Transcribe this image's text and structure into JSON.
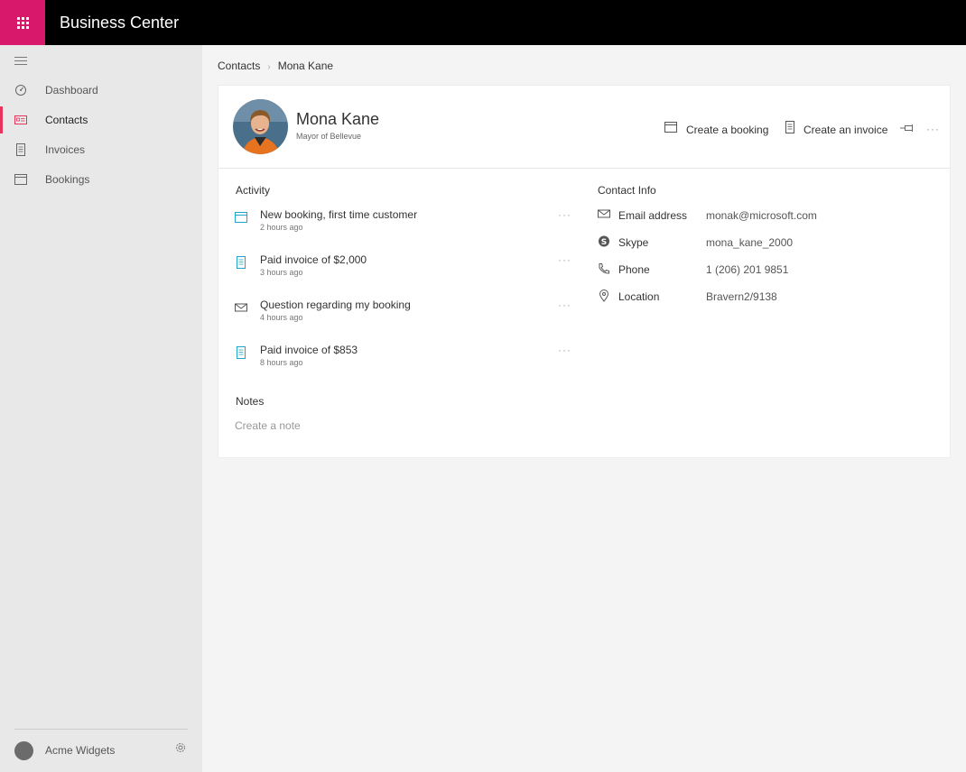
{
  "app": {
    "title": "Business Center"
  },
  "sidebar": {
    "items": [
      {
        "label": "Dashboard",
        "icon": "dashboard-icon"
      },
      {
        "label": "Contacts",
        "icon": "contact-card-icon",
        "active": true
      },
      {
        "label": "Invoices",
        "icon": "invoice-icon"
      },
      {
        "label": "Bookings",
        "icon": "calendar-icon"
      }
    ],
    "org": {
      "name": "Acme Widgets"
    }
  },
  "breadcrumb": {
    "parent": "Contacts",
    "current": "Mona Kane"
  },
  "contact": {
    "name": "Mona Kane",
    "title": "Mayor of Bellevue",
    "actions": {
      "booking": "Create a booking",
      "invoice": "Create an invoice"
    }
  },
  "activity": {
    "title": "Activity",
    "items": [
      {
        "title": "New booking, first time customer",
        "time": "2 hours ago",
        "icon": "calendar-icon"
      },
      {
        "title": "Paid invoice of $2,000",
        "time": "3 hours ago",
        "icon": "invoice-icon"
      },
      {
        "title": "Question regarding my booking",
        "time": "4 hours ago",
        "icon": "mail-icon"
      },
      {
        "title": "Paid invoice of $853",
        "time": "8 hours ago",
        "icon": "invoice-icon"
      }
    ]
  },
  "contact_info": {
    "title": "Contact Info",
    "rows": [
      {
        "label": "Email address",
        "value": "monak@microsoft.com",
        "icon": "mail-icon"
      },
      {
        "label": "Skype",
        "value": "mona_kane_2000",
        "icon": "skype-icon"
      },
      {
        "label": "Phone",
        "value": "1 (206) 201 9851",
        "icon": "phone-icon"
      },
      {
        "label": "Location",
        "value": "Bravern2/9138",
        "icon": "location-pin-icon"
      }
    ]
  },
  "notes": {
    "title": "Notes",
    "placeholder": "Create a note"
  },
  "colors": {
    "brand": "#d8196b",
    "accent": "#e8335c",
    "topbar": "#000000",
    "activity_icon": "#21a6c9"
  }
}
